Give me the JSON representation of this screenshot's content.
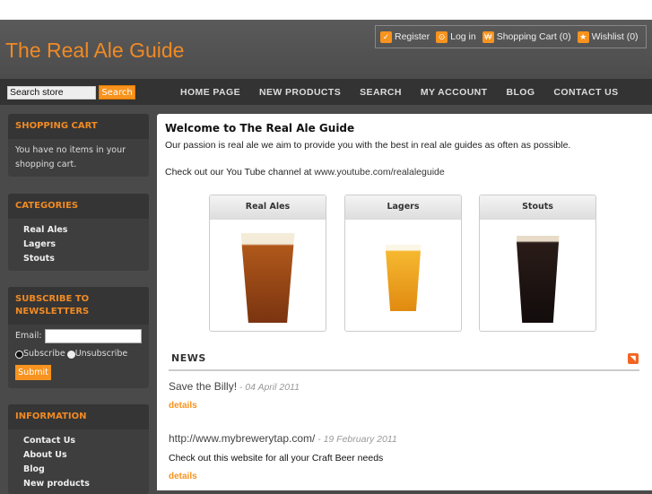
{
  "header": {
    "logo": "The Real Ale Guide",
    "links": [
      {
        "label": "Register",
        "icon": "✓"
      },
      {
        "label": "Log in",
        "icon": "🔓"
      },
      {
        "label": "Shopping Cart (0)",
        "icon": "₩"
      },
      {
        "label": "Wishlist (0)",
        "icon": "★"
      }
    ]
  },
  "nav": {
    "search_value": "Search store",
    "search_button": "Search",
    "menu": [
      "HOME PAGE",
      "NEW PRODUCTS",
      "SEARCH",
      "MY ACCOUNT",
      "BLOG",
      "CONTACT US"
    ]
  },
  "sidebar": {
    "cart": {
      "title": "SHOPPING CART",
      "text": "You have no items in your shopping cart."
    },
    "categories": {
      "title": "CATEGORIES",
      "items": [
        "Real Ales",
        "Lagers",
        "Stouts"
      ]
    },
    "newsletter": {
      "title": "SUBSCRIBE TO NEWSLETTERS",
      "email_label": "Email:",
      "subscribe": "Subscribe",
      "unsubscribe": "Unsubscribe",
      "submit": "Submit"
    },
    "information": {
      "title": "INFORMATION",
      "items": [
        "Contact Us",
        "About Us",
        "Blog",
        "New products"
      ]
    }
  },
  "main": {
    "title": "Welcome to The Real Ale Guide",
    "intro": "Our passion is real ale we aim to provide you with the best in real ale guides as often as possible.",
    "youtube_text": "Check out our You Tube channel at ",
    "youtube_link": "www.youtube.com/realaleguide",
    "products": [
      {
        "name": "Real Ales",
        "color": "#9a4a14"
      },
      {
        "name": "Lagers",
        "color": "#f0a020"
      },
      {
        "name": "Stouts",
        "color": "#1e1414"
      }
    ],
    "news": {
      "title": "NEWS",
      "items": [
        {
          "title": "Save the Billy!",
          "date": "- 04 April 2011",
          "body": "",
          "details": "details"
        },
        {
          "title": "http://www.mybrewerytap.com/",
          "date": "- 19 February 2011",
          "body": "Check out this website for all your Craft Beer needs",
          "details": "details"
        }
      ]
    }
  }
}
